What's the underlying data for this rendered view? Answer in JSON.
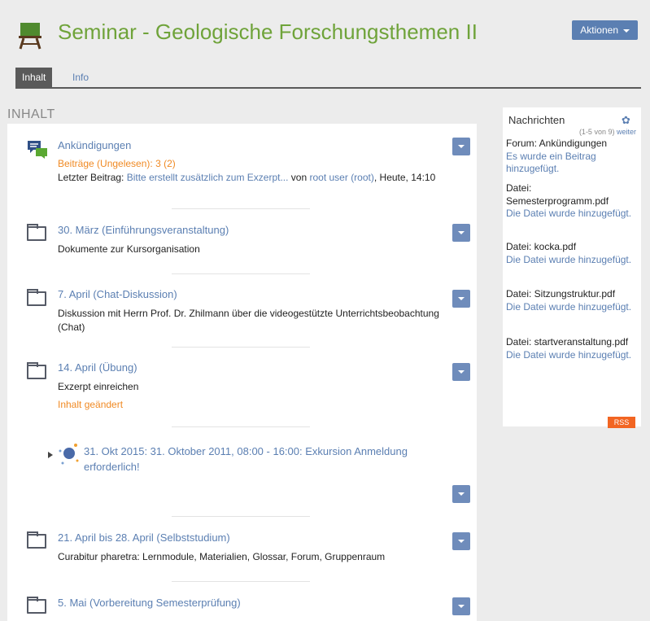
{
  "header": {
    "title": "Seminar - Geologische Forschungsthemen II",
    "actions_label": "Aktionen"
  },
  "tabs": [
    {
      "label": "Inhalt",
      "active": true
    },
    {
      "label": "Info",
      "active": false
    }
  ],
  "content": {
    "heading": "INHALT",
    "items": [
      {
        "type": "forum",
        "name": "Ankündigungen",
        "status": "Beiträge (Ungelesen): 3 (2)",
        "last_post_prefix": "Letzter Beitrag:",
        "last_post_title": "Bitte erstellt zusätzlich zum Exzerpt...",
        "last_post_by": "von",
        "last_post_author": "root user (root)",
        "last_post_time": ", Heute, 14:10"
      },
      {
        "type": "folder",
        "name": "30. März (Einführungsveranstaltung)",
        "description": "Dokumente zur Kursorganisation"
      },
      {
        "type": "folder",
        "name": "7. April (Chat-Diskussion)",
        "description": "Diskussion mit Herrn Prof. Dr. Zhilmann über die videogestützte Unterrichtsbeobachtung (Chat)"
      },
      {
        "type": "folder",
        "name": "14. April (Übung)",
        "description": "Exzerpt einreichen",
        "status": "Inhalt geändert"
      },
      {
        "type": "event",
        "name": "31. Okt 2015: 31. Oktober 2011, 08:00 - 16:00: Exkursion Anmeldung erforderlich!"
      },
      {
        "type": "folder",
        "name": "21. April bis 28. April (Selbststudium)",
        "description": "Curabitur pharetra: Lernmodule, Materialien, Glossar, Forum, Gruppenraum"
      },
      {
        "type": "folder",
        "name": "5. Mai (Vorbereitung Semesterprüfung)"
      }
    ]
  },
  "sidebar": {
    "title": "Nachrichten",
    "count": "(1-5 von 9)",
    "more": "weiter",
    "entries": [
      {
        "heading": "Forum: Ankündigungen",
        "text": "Es wurde ein Beitrag hinzugefügt."
      },
      {
        "heading": "Datei: Semesterprogramm.pdf",
        "text": "Die Datei wurde hinzugefügt."
      },
      {
        "heading": "Datei: kocka.pdf",
        "text": "Die Datei wurde hinzugefügt."
      },
      {
        "heading": "Datei: Sitzungstruktur.pdf",
        "text": "Die Datei wurde hinzugefügt."
      },
      {
        "heading": "Datei: startveranstaltung.pdf",
        "text": "Die Datei wurde hinzugefügt."
      }
    ],
    "rss_label": "RSS"
  },
  "colors": {
    "title_green": "#6fa33a",
    "link_blue": "#5b7fb2",
    "orange": "#f08a24",
    "rss_orange": "#f26522"
  },
  "icons": [
    "course-icon",
    "forum-icon",
    "folder-icon",
    "event-icon",
    "gear-icon",
    "expand-arrow-icon",
    "chevron-down-icon"
  ]
}
